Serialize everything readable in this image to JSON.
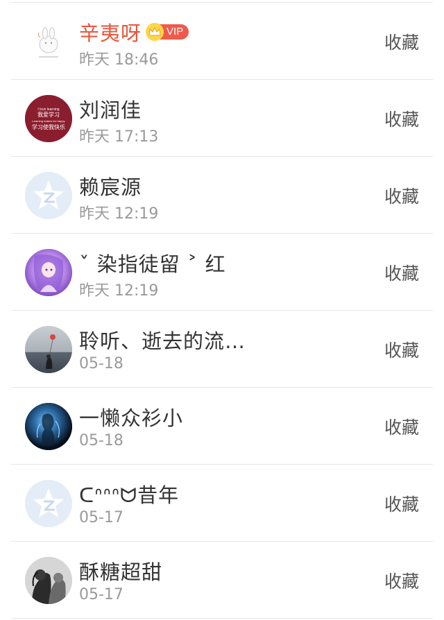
{
  "items": [
    {
      "name": "辛夷呀",
      "time": "昨天 18:46",
      "action": "收藏",
      "vip": true,
      "vip_label": "VIP",
      "avatar": "white-bunny-logo"
    },
    {
      "name": "刘润佳",
      "time": "昨天 17:13",
      "action": "收藏",
      "avatar": "study-happy-text-avatar",
      "avatar_text": [
        "I love learning",
        "我爱学习",
        "Learning makes me happy",
        "学习使我快乐"
      ]
    },
    {
      "name": "赖宸源",
      "time": "昨天 12:19",
      "action": "收藏",
      "avatar": "default-qzone-star-avatar"
    },
    {
      "name": "ˇ 染指徒留 ˃ 红",
      "time": "昨天 12:19",
      "action": "收藏",
      "avatar": "anime-girl-purple-avatar"
    },
    {
      "name": "聆听、逝去的流…",
      "time": "05-18",
      "action": "收藏",
      "avatar": "girl-balloon-sea-avatar"
    },
    {
      "name": "一懒众衫小",
      "time": "05-18",
      "action": "收藏",
      "avatar": "glowing-figure-dark-avatar"
    },
    {
      "name": "ᑕᐢᐢᐢᗢ昔年",
      "time": "05-17",
      "action": "收藏",
      "avatar": "default-qzone-star-avatar"
    },
    {
      "name": "酥糖超甜",
      "time": "05-17",
      "action": "收藏",
      "avatar": "bw-couple-photo-avatar"
    }
  ],
  "colors": {
    "vip_name": "#e8553a",
    "name": "#333333",
    "time": "#9a9a9a",
    "action": "#555555",
    "divider": "#e6e6e6",
    "vip_pill": "#ef5a4a",
    "vip_crown": "#ffd54a"
  }
}
